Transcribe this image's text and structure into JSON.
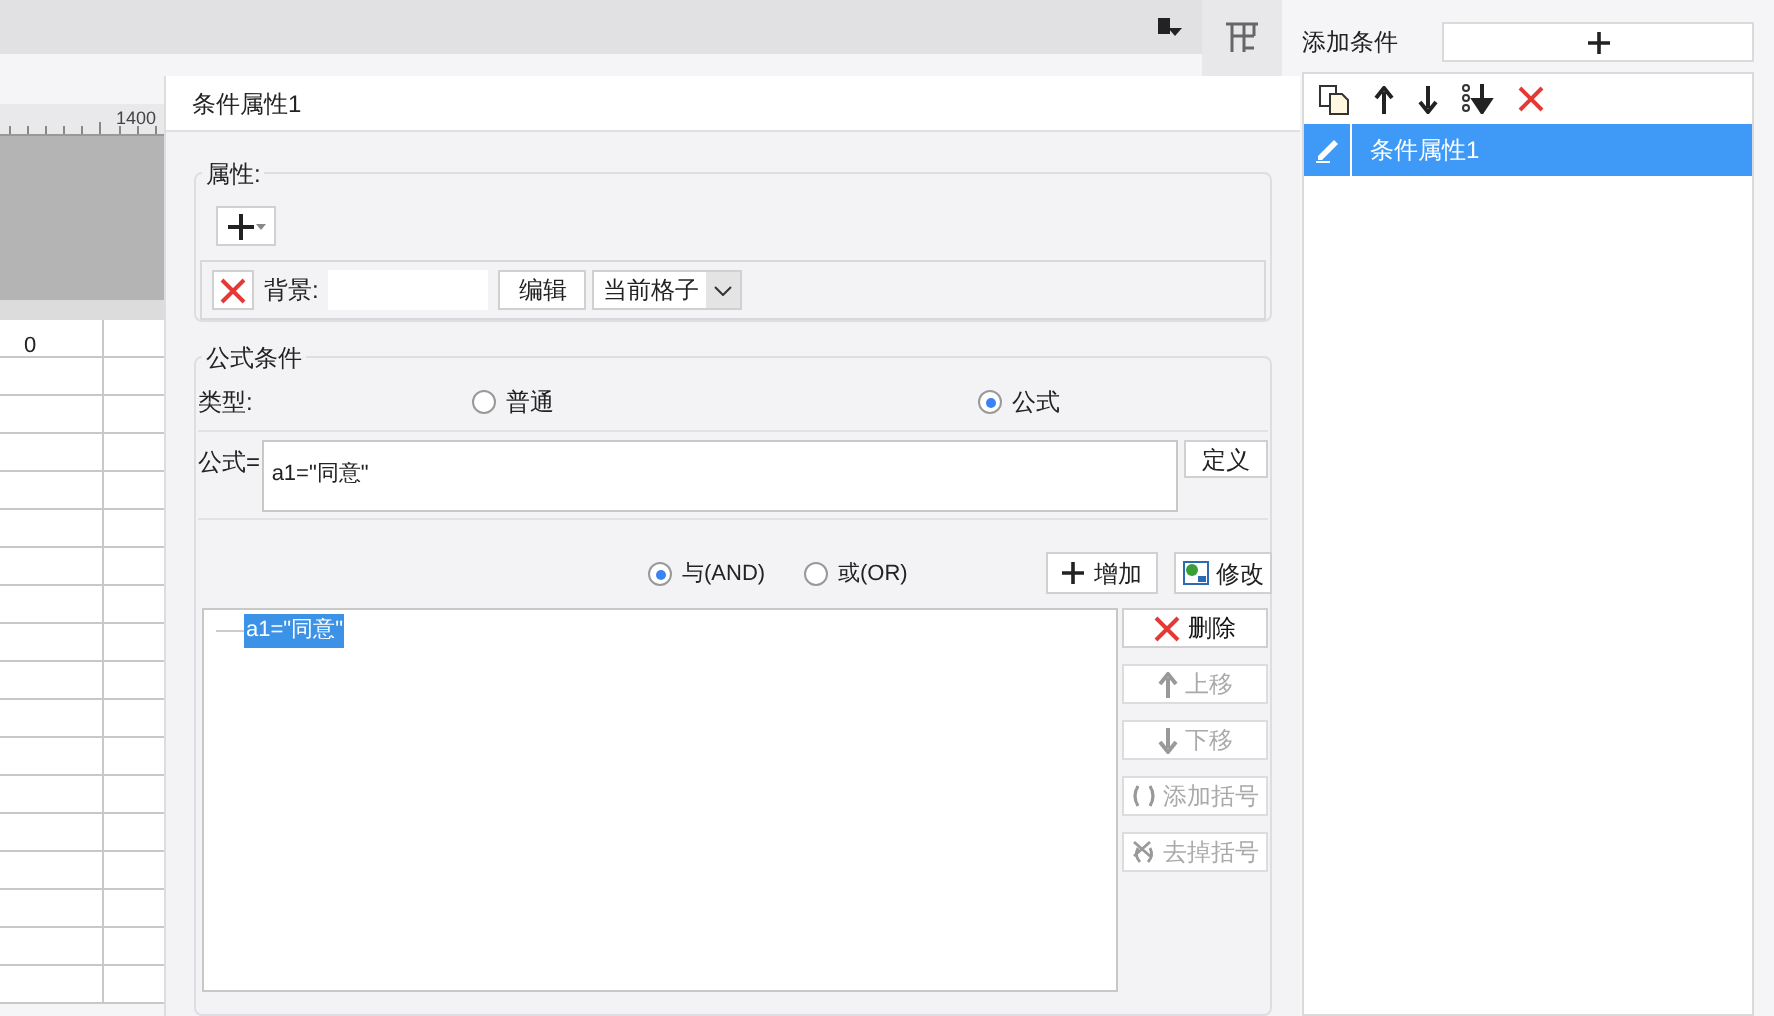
{
  "ruler": {
    "label": "1400"
  },
  "sheet": {
    "cell": "0"
  },
  "dialog": {
    "title": "条件属性1",
    "properties": {
      "legend": "属性:",
      "background_label": "背景:",
      "edit_button": "编辑",
      "scope": "当前格子"
    },
    "formula_condition": {
      "legend": "公式条件",
      "type_label": "类型:",
      "types": [
        {
          "label": "普通",
          "selected": false
        },
        {
          "label": "公式",
          "selected": true
        }
      ],
      "formula_label": "公式=",
      "formula": "a1=\"同意\"",
      "define_button": "定义",
      "logic": [
        {
          "label": "与(AND)",
          "selected": true
        },
        {
          "label": "或(OR)",
          "selected": false
        }
      ],
      "add_button": "增加",
      "modify_button": "修改",
      "conditions": [
        {
          "text": "a1=\"同意\"",
          "selected": true
        }
      ],
      "actions": [
        {
          "kind": "delete",
          "label": "删除",
          "disabled": false
        },
        {
          "kind": "up",
          "label": "上移",
          "disabled": true
        },
        {
          "kind": "down",
          "label": "下移",
          "disabled": true
        },
        {
          "kind": "add-paren",
          "label": "添加括号",
          "disabled": true
        },
        {
          "kind": "remove-paren",
          "label": "去掉括号",
          "disabled": true
        }
      ]
    }
  },
  "conditions_panel": {
    "add_label": "添加条件",
    "items": [
      {
        "label": "条件属性1",
        "selected": true
      }
    ]
  }
}
